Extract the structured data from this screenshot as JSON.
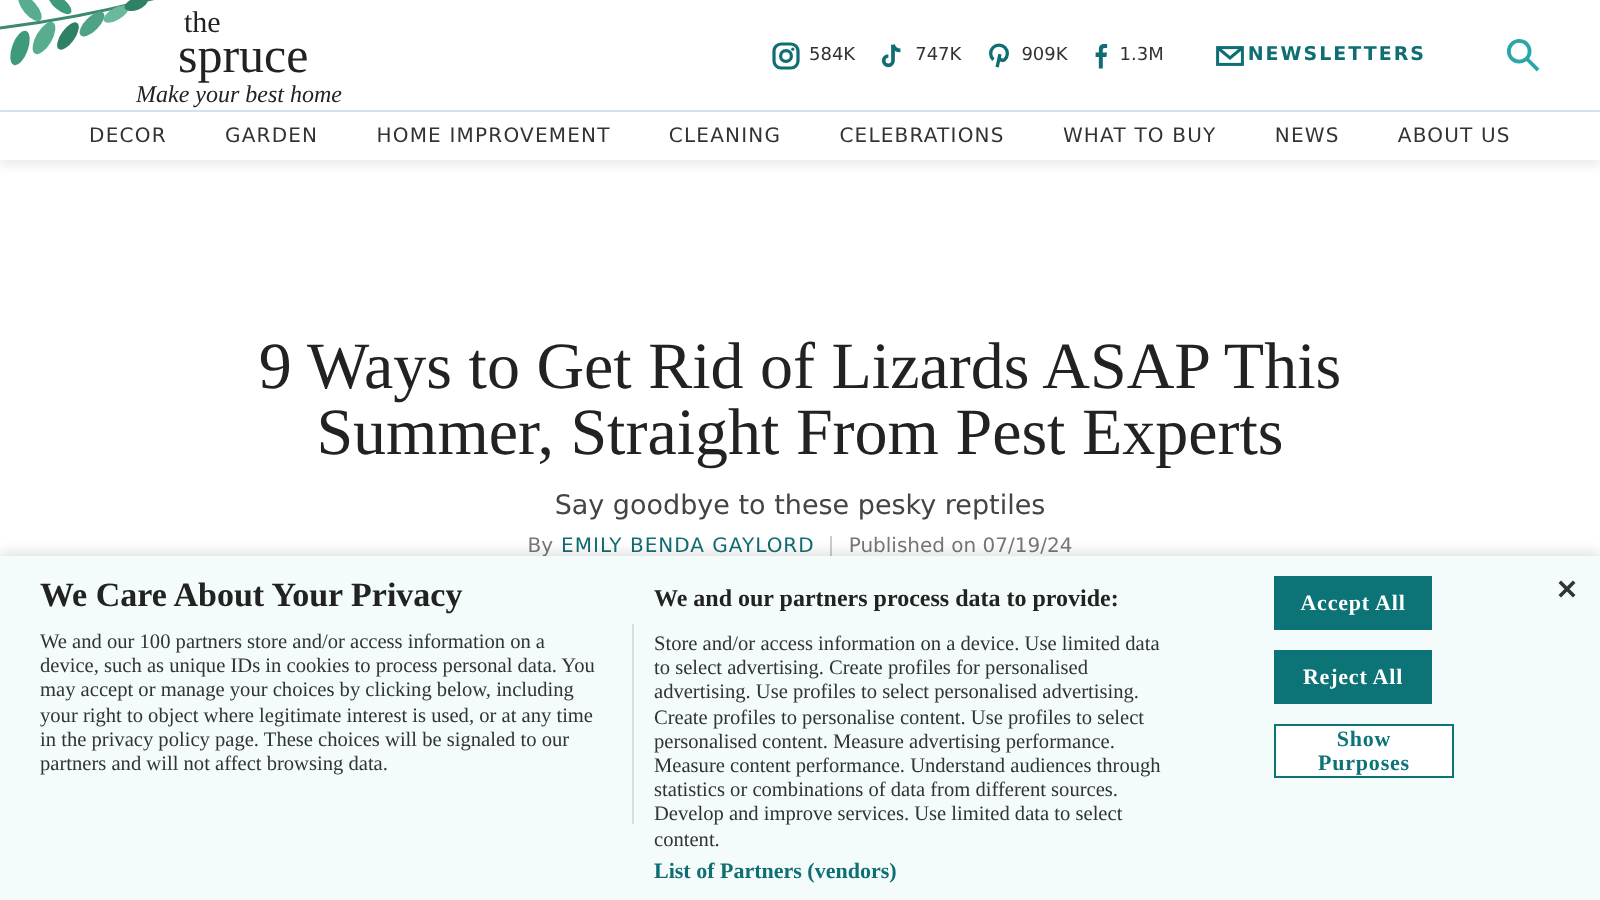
{
  "logo": {
    "small": "the",
    "name": "spruce",
    "tagline": "Make your best home"
  },
  "social": [
    {
      "kind": "instagram",
      "count": "584K"
    },
    {
      "kind": "tiktok",
      "count": "747K"
    },
    {
      "kind": "pinterest",
      "count": "909K"
    },
    {
      "kind": "facebook",
      "count": "1.3M"
    }
  ],
  "newsletters": "NEWSLETTERS",
  "nav": [
    "DECOR",
    "GARDEN",
    "HOME IMPROVEMENT",
    "CLEANING",
    "CELEBRATIONS",
    "WHAT TO BUY",
    "NEWS",
    "ABOUT US"
  ],
  "article": {
    "title": "9 Ways to Get Rid of Lizards ASAP This Summer, Straight From Pest Experts",
    "subtitle": "Say goodbye to these pesky reptiles",
    "by": "By",
    "author": "EMILY BENDA GAYLORD",
    "published": "Published on 07/19/24"
  },
  "consent": {
    "title": "We Care About Your Privacy",
    "body": "We and our 100 partners store and/or access information on a device, such as unique IDs in cookies to process personal data. You may accept or manage your choices by clicking below, including your right to object where legitimate interest is used, or at any time in the privacy policy page. These choices will be signaled to our partners and will not affect browsing data.",
    "purposes_title": "We and our partners process data to provide:",
    "purposes": "Store and/or access information on a device. Use limited data to select advertising. Create profiles for personalised advertising. Use profiles to select personalised advertising. Create profiles to personalise content. Use profiles to select personalised content. Measure advertising performance. Measure content performance. Understand audiences through statistics or combinations of data from different sources. Develop and improve services. Use limited data to select content.",
    "partners_link": "List of Partners (vendors)",
    "buttons": [
      {
        "label": "Accept All",
        "kind": "primary"
      },
      {
        "label": "Reject All",
        "kind": "primary"
      },
      {
        "label": "Show Purposes",
        "kind": "outline"
      }
    ]
  }
}
